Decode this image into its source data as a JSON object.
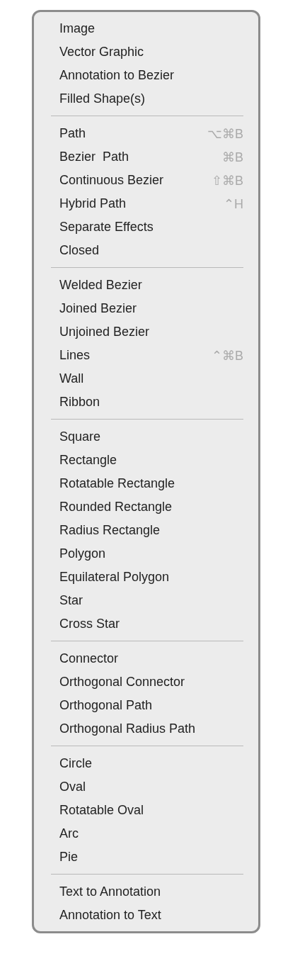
{
  "menu": {
    "sections": [
      {
        "items": [
          {
            "label": "Image"
          },
          {
            "label": "Vector Graphic"
          },
          {
            "label": "Annotation to Bezier"
          },
          {
            "label": "Filled Shape(s)"
          }
        ]
      },
      {
        "items": [
          {
            "label": "Path",
            "shortcut": "⌥⌘B"
          },
          {
            "label": "Bezier  Path",
            "shortcut": "⌘B"
          },
          {
            "label": "Continuous Bezier",
            "shortcut": "⇧⌘B"
          },
          {
            "label": "Hybrid Path",
            "shortcut": "⌃H"
          },
          {
            "label": "Separate Effects"
          },
          {
            "label": "Closed"
          }
        ]
      },
      {
        "items": [
          {
            "label": "Welded Bezier"
          },
          {
            "label": "Joined Bezier"
          },
          {
            "label": "Unjoined Bezier"
          },
          {
            "label": "Lines",
            "shortcut": "⌃⌘B"
          },
          {
            "label": "Wall"
          },
          {
            "label": "Ribbon"
          }
        ]
      },
      {
        "items": [
          {
            "label": "Square"
          },
          {
            "label": "Rectangle"
          },
          {
            "label": "Rotatable Rectangle"
          },
          {
            "label": "Rounded Rectangle"
          },
          {
            "label": "Radius Rectangle"
          },
          {
            "label": "Polygon"
          },
          {
            "label": "Equilateral Polygon"
          },
          {
            "label": "Star"
          },
          {
            "label": "Cross Star"
          }
        ]
      },
      {
        "items": [
          {
            "label": "Connector"
          },
          {
            "label": "Orthogonal Connector"
          },
          {
            "label": "Orthogonal Path"
          },
          {
            "label": "Orthogonal Radius Path"
          }
        ]
      },
      {
        "items": [
          {
            "label": "Circle"
          },
          {
            "label": "Oval"
          },
          {
            "label": "Rotatable Oval"
          },
          {
            "label": "Arc"
          },
          {
            "label": "Pie"
          }
        ]
      },
      {
        "items": [
          {
            "label": "Text to Annotation"
          },
          {
            "label": "Annotation to Text"
          }
        ]
      }
    ]
  }
}
